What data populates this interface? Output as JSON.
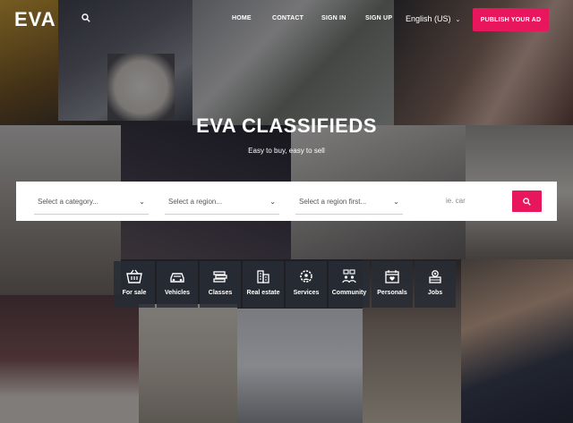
{
  "brand": {
    "name": "EVA"
  },
  "nav": {
    "home": "HOME",
    "contact": "CONTACT",
    "sign_in": "SIGN IN",
    "sign_up": "SIGN UP"
  },
  "language": {
    "label": "English (US)"
  },
  "publish_button": "PUBLISH YOUR AD",
  "hero": {
    "title": "EVA CLASSIFIEDS",
    "subtitle": "Easy to buy, easy to sell"
  },
  "search": {
    "category": "Select a category...",
    "region": "Select a region...",
    "city": "Select a region first...",
    "keyword_placeholder": "ie. car"
  },
  "categories": [
    {
      "label": "For sale",
      "icon": "basket-icon"
    },
    {
      "label": "Vehicles",
      "icon": "car-icon"
    },
    {
      "label": "Classes",
      "icon": "books-icon"
    },
    {
      "label": "Real estate",
      "icon": "building-icon"
    },
    {
      "label": "Services",
      "icon": "gear-person-icon"
    },
    {
      "label": "Community",
      "icon": "chat-people-icon"
    },
    {
      "label": "Personals",
      "icon": "calendar-heart-icon"
    },
    {
      "label": "Jobs",
      "icon": "briefcase-person-icon"
    }
  ],
  "colors": {
    "accent": "#e8175d",
    "tile_bg": "#2b2f36"
  }
}
